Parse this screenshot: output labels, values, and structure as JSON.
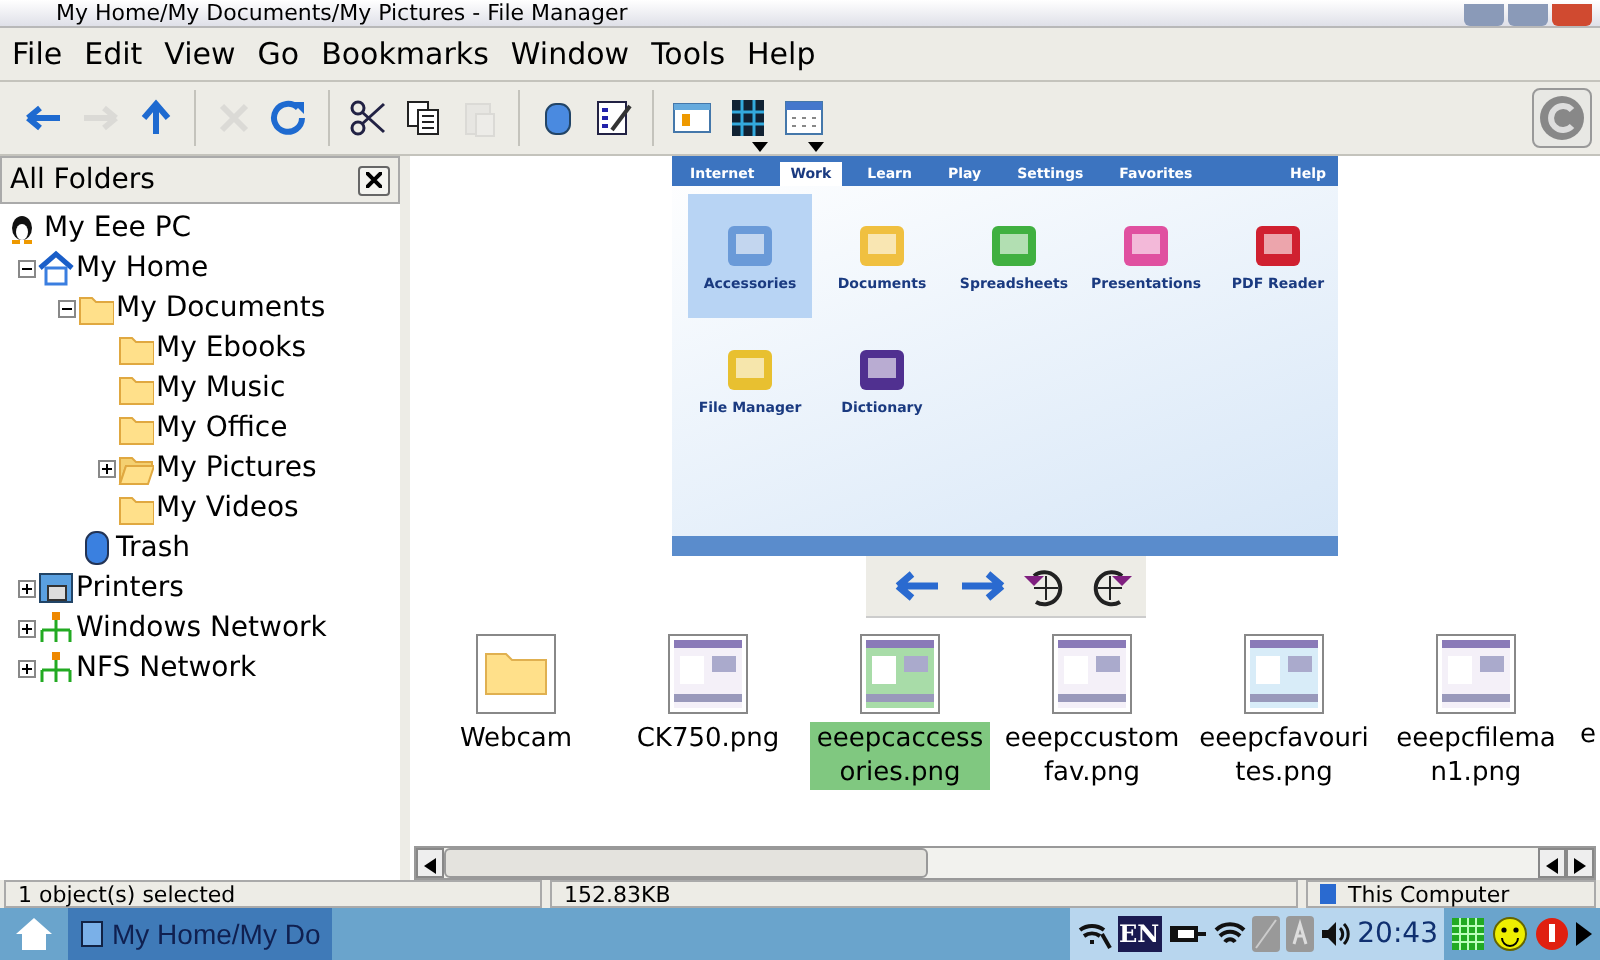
{
  "window": {
    "title": "My Home/My Documents/My Pictures - File Manager"
  },
  "menu": [
    "File",
    "Edit",
    "View",
    "Go",
    "Bookmarks",
    "Window",
    "Tools",
    "Help"
  ],
  "toolbar": [
    {
      "kind": "back",
      "disabled": false,
      "dropdown": false
    },
    {
      "kind": "forward",
      "disabled": true,
      "dropdown": false
    },
    {
      "kind": "up",
      "disabled": false,
      "dropdown": false
    },
    {
      "kind": "sep"
    },
    {
      "kind": "stop",
      "disabled": true,
      "dropdown": false
    },
    {
      "kind": "reload",
      "disabled": false,
      "dropdown": false
    },
    {
      "kind": "sep"
    },
    {
      "kind": "cut",
      "disabled": false,
      "dropdown": false
    },
    {
      "kind": "copy",
      "disabled": false,
      "dropdown": false
    },
    {
      "kind": "paste",
      "disabled": true,
      "dropdown": false
    },
    {
      "kind": "sep"
    },
    {
      "kind": "trash",
      "disabled": false,
      "dropdown": false
    },
    {
      "kind": "properties",
      "disabled": false,
      "dropdown": false
    },
    {
      "kind": "sep"
    },
    {
      "kind": "panel",
      "disabled": false,
      "dropdown": false
    },
    {
      "kind": "thumbs",
      "disabled": false,
      "dropdown": true
    },
    {
      "kind": "details",
      "disabled": false,
      "dropdown": true
    }
  ],
  "sidebar": {
    "title": "All Folders",
    "tree": [
      {
        "label": "My Eee PC",
        "kind": "computer",
        "children": [
          {
            "label": "My Home",
            "kind": "home",
            "expanded": true,
            "children": [
              {
                "label": "My Documents",
                "kind": "folder",
                "expanded": true,
                "children": [
                  {
                    "label": "My Ebooks",
                    "kind": "folder"
                  },
                  {
                    "label": "My Music",
                    "kind": "folder"
                  },
                  {
                    "label": "My Office",
                    "kind": "folder"
                  },
                  {
                    "label": "My Pictures",
                    "kind": "openfolder",
                    "expanded": false
                  },
                  {
                    "label": "My Videos",
                    "kind": "folder"
                  }
                ]
              },
              {
                "label": "Trash",
                "kind": "trash"
              }
            ]
          },
          {
            "label": "Printers",
            "kind": "printer",
            "expanded": false
          },
          {
            "label": "Windows Network",
            "kind": "network",
            "expanded": false
          },
          {
            "label": "NFS Network",
            "kind": "network",
            "expanded": false
          }
        ]
      }
    ]
  },
  "preview": {
    "tabs": [
      {
        "label": "Internet",
        "selected": false
      },
      {
        "label": "Work",
        "selected": true
      },
      {
        "label": "Learn",
        "selected": false
      },
      {
        "label": "Play",
        "selected": false
      },
      {
        "label": "Settings",
        "selected": false
      },
      {
        "label": "Favorites",
        "selected": false
      }
    ],
    "help": "Help",
    "apps": [
      {
        "label": "Accessories",
        "selected": true
      },
      {
        "label": "Documents",
        "selected": false
      },
      {
        "label": "Spreadsheets",
        "selected": false
      },
      {
        "label": "Presentations",
        "selected": false
      },
      {
        "label": "PDF Reader",
        "selected": false
      },
      {
        "label": "File Manager",
        "selected": false
      },
      {
        "label": "Dictionary",
        "selected": false
      }
    ]
  },
  "viewer_buttons": [
    {
      "kind": "back"
    },
    {
      "kind": "forward"
    },
    {
      "kind": "rotate-left"
    },
    {
      "kind": "rotate-right"
    }
  ],
  "files": [
    {
      "label": "Webcam",
      "kind": "folder",
      "selected": false
    },
    {
      "label": "CK750.png",
      "selected": false
    },
    {
      "label": "eeepcaccessories.png",
      "selected": true
    },
    {
      "label": "eeepccustomfav.png",
      "selected": false
    },
    {
      "label": "eeepcfavourites.png",
      "selected": false
    },
    {
      "label": "eeepcfileman1.png",
      "selected": false
    },
    {
      "label": "e",
      "kind": "cut",
      "selected": false
    }
  ],
  "status_bar": [
    "1 object(s) selected",
    "152.83KB",
    "This Computer"
  ],
  "taskbar": {
    "window": "My Home/My Do",
    "tray": [
      {
        "kind": "wifi-tool"
      },
      {
        "kind": "lang",
        "text": "EN"
      },
      {
        "kind": "plug"
      },
      {
        "kind": "wifi"
      },
      {
        "kind": "desk"
      },
      {
        "kind": "font"
      },
      {
        "kind": "volume"
      },
      {
        "kind": "clock",
        "text": "20:43"
      },
      {
        "kind": "grid"
      },
      {
        "kind": "smiley"
      },
      {
        "kind": "power"
      },
      {
        "kind": "more"
      }
    ]
  }
}
